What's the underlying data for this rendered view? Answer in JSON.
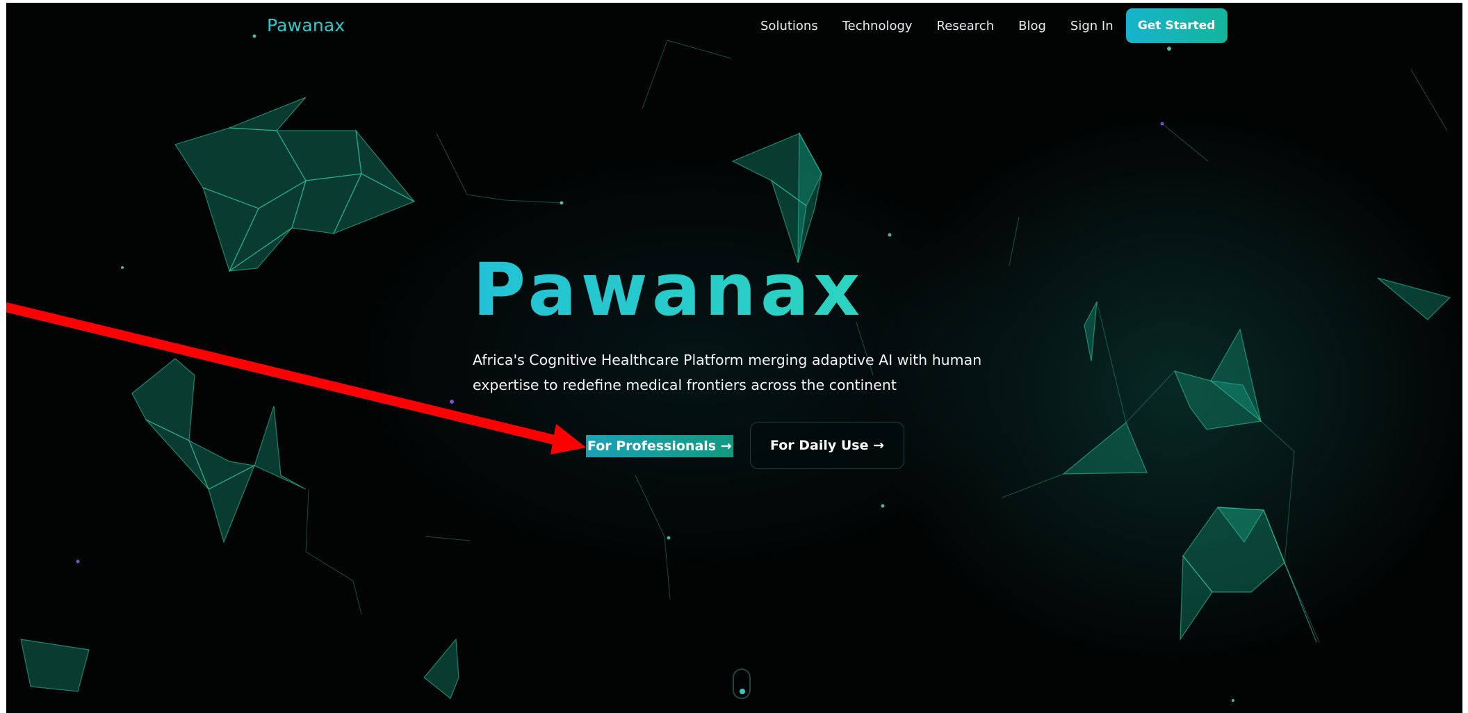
{
  "brand": {
    "name": "Pawanax"
  },
  "nav": {
    "items": [
      {
        "label": "Solutions"
      },
      {
        "label": "Technology"
      },
      {
        "label": "Research"
      },
      {
        "label": "Blog"
      },
      {
        "label": "Sign In"
      }
    ],
    "cta_label": "Get Started"
  },
  "hero": {
    "title": "Pawanax",
    "subtitle_line1": "Africa's Cognitive Healthcare Platform merging adaptive AI with human",
    "subtitle_line2": "expertise to redefine medical frontiers across the continent",
    "primary_button": "For Professionals →",
    "secondary_button": "For Daily Use →"
  },
  "colors": {
    "accent_cyan": "#22c2d6",
    "accent_teal": "#2dd4bf",
    "background": "#020404",
    "annotation_arrow": "#ff0000"
  },
  "icons": {
    "scroll_indicator": "mouse-scroll-icon"
  }
}
